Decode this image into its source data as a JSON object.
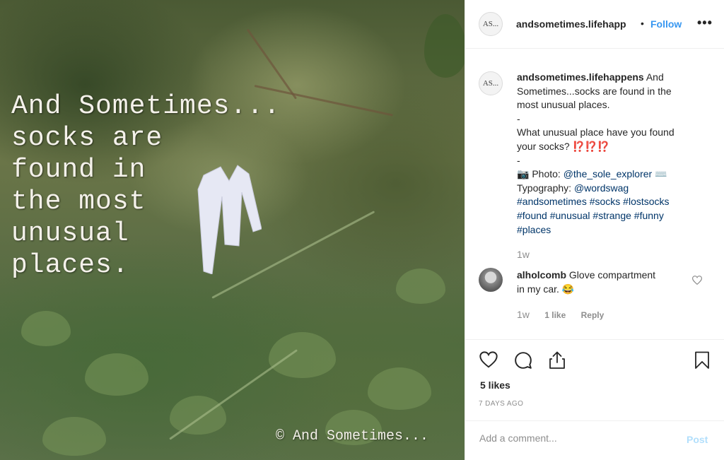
{
  "photo": {
    "overlay_lines": [
      "And Sometimes...",
      "socks are",
      "found in",
      "the most",
      "unusual",
      "places."
    ],
    "copyright": "© And Sometimes..."
  },
  "post_header": {
    "avatar_text": "AS...",
    "username": "andsometimes.lifehapp",
    "separator": "•",
    "follow_label": "Follow",
    "more_label": "•••"
  },
  "caption": {
    "avatar_text": "AS...",
    "username": "andsometimes.lifehappens",
    "line1_text": "And",
    "line2": "Sometimes...socks are found in the",
    "line3": "most unusual places.",
    "line4": "-",
    "line5": "What unusual place have you found",
    "line6_text": "your socks?",
    "line6_emoji": "⁉️⁉️⁉️",
    "line7": "-",
    "line8_prefix": "📷 Photo:",
    "line8_mention": "@the_sole_explorer",
    "line8_suffix": "⌨️",
    "line9_prefix": "Typography:",
    "line9_mention": "@wordswag",
    "hashtags_line1": "#andsometimes #socks #lostsocks",
    "hashtags_line2": "#found #unusual #strange #funny",
    "hashtags_line3": "#places",
    "time": "1w"
  },
  "comment": {
    "username": "alholcomb",
    "text_line1": "Glove compartment",
    "text_line2": "in my car. 😂",
    "time": "1w",
    "likes": "1 like",
    "reply_label": "Reply"
  },
  "actions": {
    "likes": "5 likes",
    "age": "7 DAYS AGO",
    "comment_placeholder": "Add a comment...",
    "post_label": "Post"
  },
  "colors": {
    "link_blue": "#3897f0",
    "tag_blue": "#003569",
    "post_disabled": "#b2dffc",
    "muted": "#8e8e8e"
  },
  "icons": [
    "heart-icon",
    "comment-icon",
    "share-icon",
    "bookmark-icon",
    "small-heart-icon"
  ]
}
